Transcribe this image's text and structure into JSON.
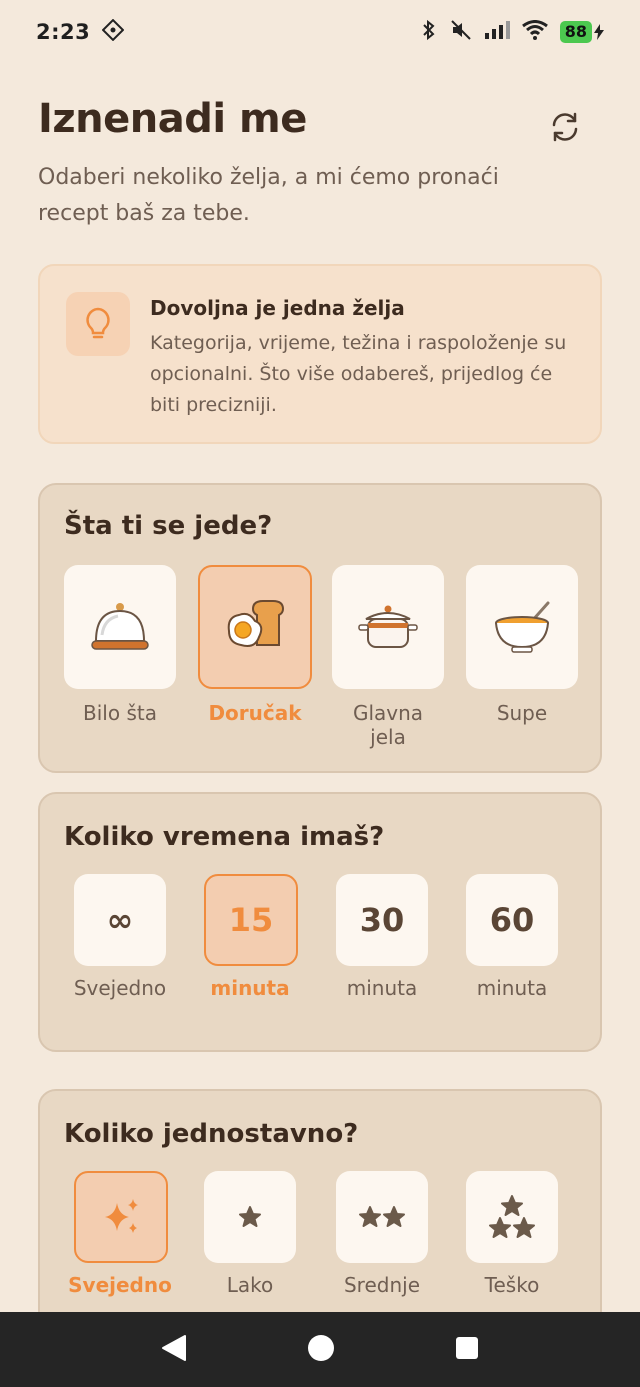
{
  "status_bar": {
    "time": "2:23",
    "battery": "88"
  },
  "header": {
    "title": "Iznenadi me",
    "subtitle": "Odaberi nekoliko želja, a mi ćemo pronaći recept baš za tebe."
  },
  "tip": {
    "title": "Dovoljna je jedna želja",
    "text": "Kategorija, vrijeme, težina i raspoloženje su opcionalni. Što više odabereš, prijedlog će biti precizniji."
  },
  "category": {
    "title": "Šta ti se jede?",
    "items": [
      {
        "label": "Bilo šta",
        "icon": "cloche-icon",
        "selected": false
      },
      {
        "label": "Doručak",
        "icon": "egg-toast-icon",
        "selected": true
      },
      {
        "label": "Glavna jela",
        "icon": "pot-icon",
        "selected": false
      },
      {
        "label": "Supe",
        "icon": "soup-bowl-icon",
        "selected": false
      }
    ]
  },
  "time_section": {
    "title": "Koliko vremena imaš?",
    "items": [
      {
        "value": "∞",
        "label": "Svejedno",
        "selected": false
      },
      {
        "value": "15",
        "label": "minuta",
        "selected": true
      },
      {
        "value": "30",
        "label": "minuta",
        "selected": false
      },
      {
        "value": "60",
        "label": "minuta",
        "selected": false
      }
    ]
  },
  "difficulty": {
    "title": "Koliko jednostavno?",
    "items": [
      {
        "label": "Svejedno",
        "icon": "sparkles-icon",
        "selected": true
      },
      {
        "label": "Lako",
        "icon": "one-star-icon",
        "selected": false
      },
      {
        "label": "Srednje",
        "icon": "two-stars-icon",
        "selected": false
      },
      {
        "label": "Teško",
        "icon": "three-stars-icon",
        "selected": false
      }
    ]
  },
  "colors": {
    "accent": "#f08c3e",
    "background": "#f4e9dc",
    "card": "#e8d8c4",
    "text": "#3d2b1f"
  }
}
